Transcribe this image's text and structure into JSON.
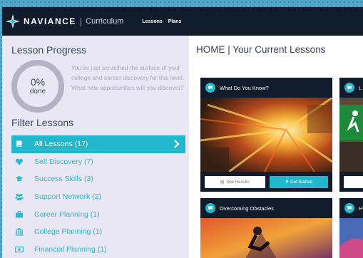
{
  "brand": {
    "name": "NAVIANCE",
    "product": "Curriculum"
  },
  "nav": {
    "items": [
      "Lessons",
      "Plans"
    ]
  },
  "sidebar": {
    "progress_title": "Lesson Progress",
    "progress_percent": "0%",
    "progress_value": 0,
    "progress_done_label": "done",
    "progress_message": "You've just scratched the surface of your college and career discovery for this level. What new opportunities will you discover?",
    "filter_title": "Filter Lessons",
    "filters": [
      {
        "label": "All Lessons (17)",
        "icon": "book-icon",
        "active": true
      },
      {
        "label": "Self Discovery (7)",
        "icon": "heart-icon",
        "active": false
      },
      {
        "label": "Success Skills (3)",
        "icon": "graduation-cap-icon",
        "active": false
      },
      {
        "label": "Support Network (2)",
        "icon": "people-icon",
        "active": false
      },
      {
        "label": "Career Planning (1)",
        "icon": "briefcase-icon",
        "active": false
      },
      {
        "label": "College Planning (1)",
        "icon": "university-icon",
        "active": false
      },
      {
        "label": "Financial Planning (1)",
        "icon": "money-icon",
        "active": false
      }
    ]
  },
  "main": {
    "title": "HOME | Your Current Lessons",
    "cards": [
      {
        "title": "What Do You Know?",
        "see_results": "See Results",
        "get_started": "Get Started"
      },
      {
        "title": "L",
        "see_results": "",
        "get_started": ""
      },
      {
        "title": "Overcoming Obstacles"
      },
      {
        "title": "H"
      }
    ]
  },
  "colors": {
    "nav_bg": "#101b2c",
    "accent": "#22b7cc",
    "sidebar_bg": "#e9e7f4"
  }
}
